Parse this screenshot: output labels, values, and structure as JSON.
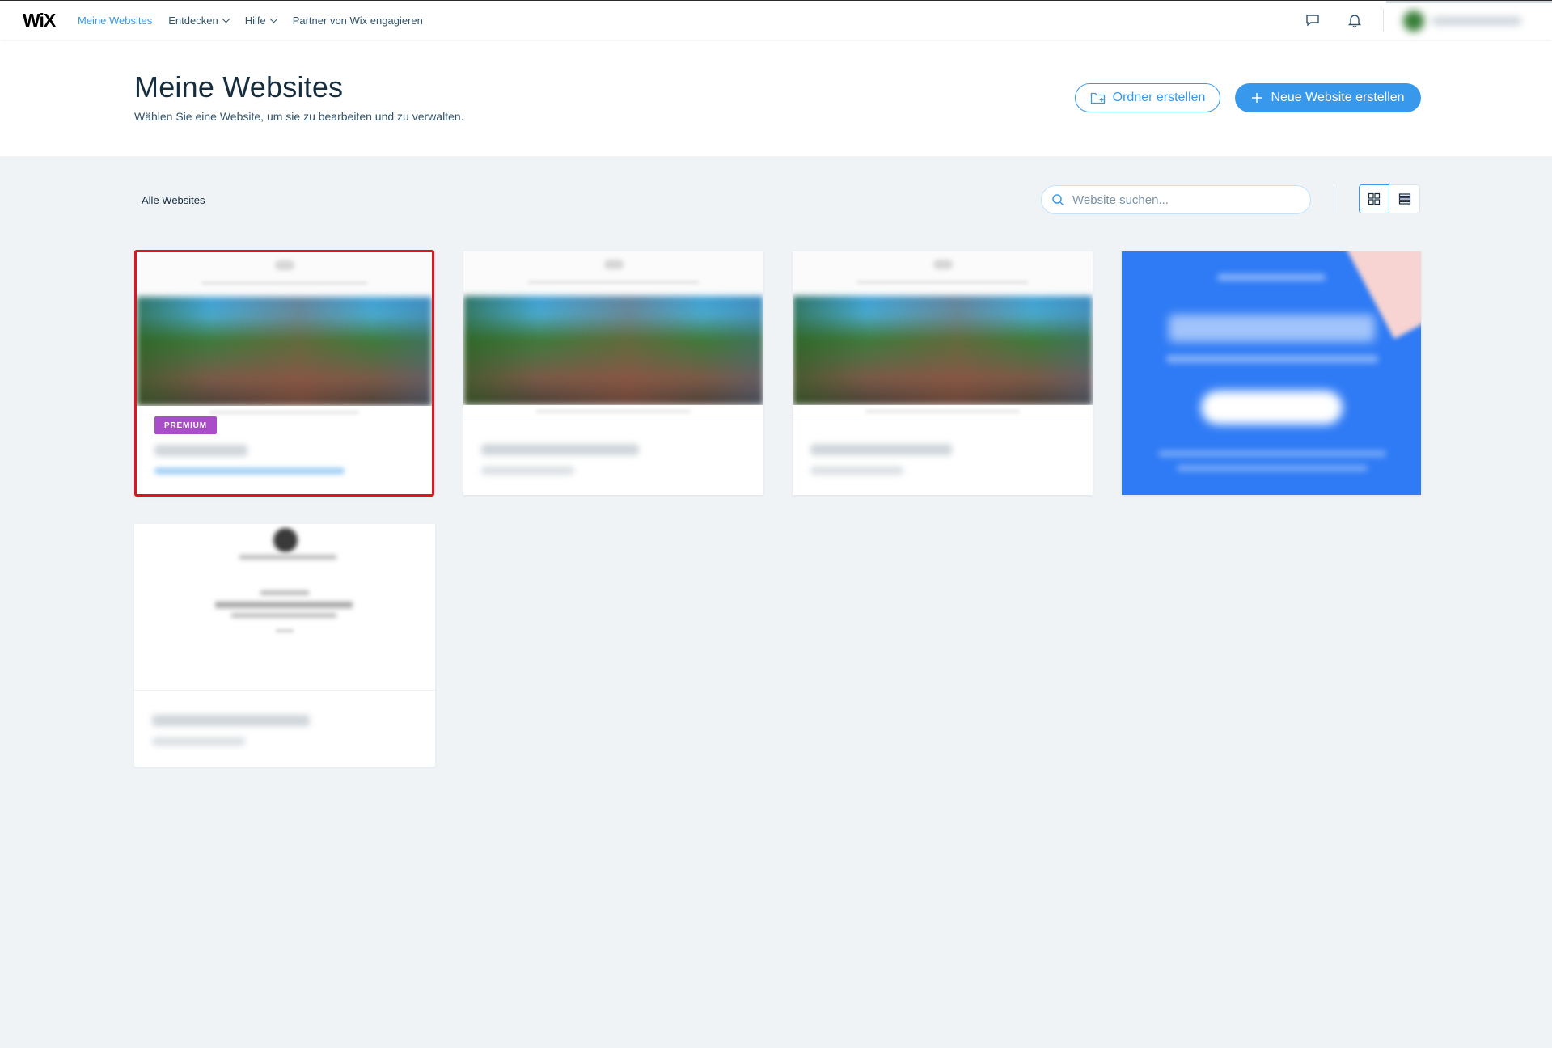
{
  "app": {
    "logo": "WiX"
  },
  "nav": {
    "items": [
      {
        "label": "Meine Websites",
        "active": true
      },
      {
        "label": "Entdecken",
        "dropdown": true
      },
      {
        "label": "Hilfe",
        "dropdown": true
      },
      {
        "label": "Partner von Wix engagieren"
      }
    ]
  },
  "topbar": {
    "icons": [
      "chat-icon",
      "bell-icon"
    ]
  },
  "header": {
    "title": "Meine Websites",
    "subtitle": "Wählen Sie eine Website, um sie zu bearbeiten und zu verwalten.",
    "folder_button": "Ordner erstellen",
    "new_button": "Neue Website erstellen"
  },
  "toolbar": {
    "filter_label": "Alle Websites",
    "search_placeholder": "Website suchen...",
    "view_modes": [
      "grid",
      "list"
    ],
    "active_view": "grid"
  },
  "cards": [
    {
      "badge": "PREMIUM",
      "selected": true
    },
    {
      "selected": false
    },
    {
      "selected": false
    },
    {
      "type": "promo"
    },
    {
      "selected": false
    }
  ],
  "colors": {
    "accent": "#3899ec",
    "premium": "#aa4dc8",
    "selection": "#e0141e",
    "promo": "#2f7bf5"
  }
}
